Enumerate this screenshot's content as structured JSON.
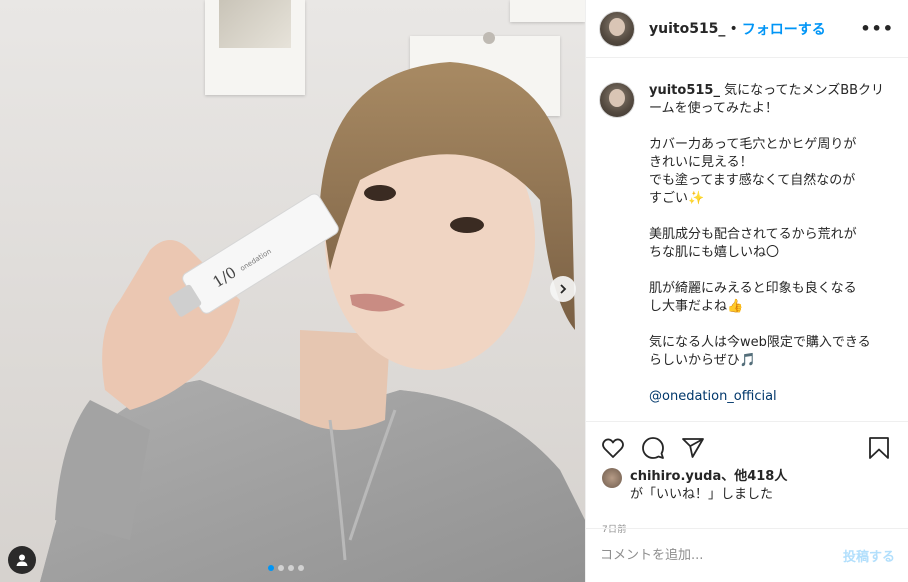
{
  "post": {
    "username": "yuito515_",
    "separator": "•",
    "follow_label": "フォローする",
    "more_label": "•••"
  },
  "caption": {
    "username": "yuito515_",
    "intro": "気になってたメンズBBクリームを使ってみたよ！",
    "para1_line1": "カバー力あって毛穴とかヒゲ周りが",
    "para1_line2": "きれいに見える！",
    "para1_line3": "でも塗ってます感なくて自然なのが",
    "para1_line4": "すごい✨",
    "para2_line1": "美肌成分も配合されてるから荒れが",
    "para2_line2": "ちな肌にも嬉しいね〇",
    "para3_line1": "肌が綺麗にみえると印象も良くなる",
    "para3_line2": "し大事だよね👍",
    "para4_line1": "気になる人は今web限定で購入できる",
    "para4_line2": "らしいからぜひ🎵",
    "mention": "@onedation_official"
  },
  "likes": {
    "user": "chihiro.yuda",
    "others": "、他418人",
    "line2": "が「いいね！」しました"
  },
  "timestamp": "7日前",
  "comment": {
    "placeholder": "コメントを追加...",
    "post_label": "投稿する"
  },
  "icons": [
    "heart-icon",
    "comment-icon",
    "share-icon",
    "bookmark-icon",
    "more-icon",
    "next-arrow-icon",
    "user-tag-icon"
  ],
  "colors": {
    "accent": "#0095f6",
    "post_disabled": "#b2dffc",
    "mention": "#00376b",
    "meta": "#8e8e8e"
  }
}
